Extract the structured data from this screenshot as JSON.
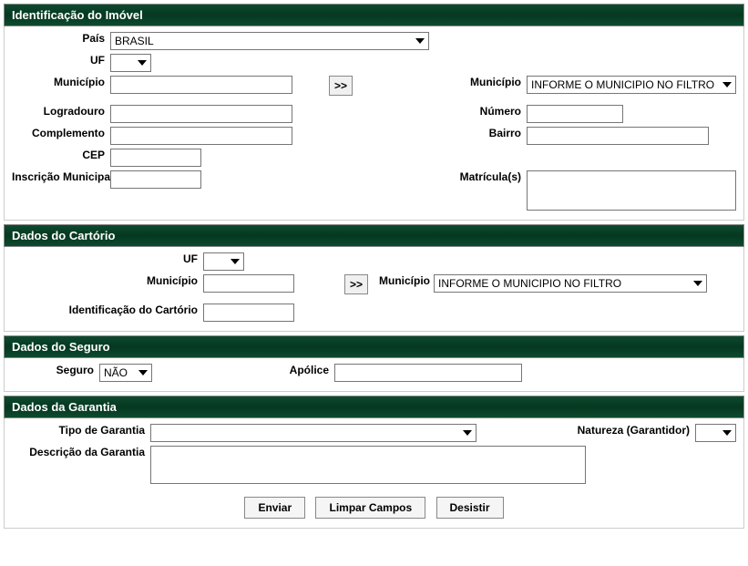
{
  "sections": {
    "imovel": {
      "title": "Identificação do Imóvel"
    },
    "cartorio": {
      "title": "Dados do Cartório"
    },
    "seguro": {
      "title": "Dados do Seguro"
    },
    "garantia": {
      "title": "Dados da Garantia"
    }
  },
  "imovel": {
    "pais_label": "País",
    "pais_value": "BRASIL",
    "uf_label": "UF",
    "uf_value": "",
    "municipio_label": "Município",
    "municipio_input": "",
    "lookup_btn": ">>",
    "municipio_select_label": "Município",
    "municipio_select_value": "INFORME O MUNICIPIO NO FILTRO",
    "logradouro_label": "Logradouro",
    "logradouro_value": "",
    "numero_label": "Número",
    "numero_value": "",
    "complemento_label": "Complemento",
    "complemento_value": "",
    "bairro_label": "Bairro",
    "bairro_value": "",
    "cep_label": "CEP",
    "cep_value": "",
    "inscricao_label": "Inscrição Municipal",
    "inscricao_value": "",
    "matriculas_label": "Matrícula(s)",
    "matriculas_value": ""
  },
  "cartorio": {
    "uf_label": "UF",
    "uf_value": "",
    "municipio_label": "Município",
    "municipio_input": "",
    "lookup_btn": ">>",
    "municipio_select_label": "Município",
    "municipio_select_value": "INFORME O MUNICIPIO NO FILTRO",
    "ident_label": "Identificação do Cartório",
    "ident_value": ""
  },
  "seguro": {
    "seguro_label": "Seguro",
    "seguro_value": "NÃO",
    "apolice_label": "Apólice",
    "apolice_value": ""
  },
  "garantia": {
    "tipo_label": "Tipo de Garantia",
    "tipo_value": "",
    "natureza_label": "Natureza (Garantidor)",
    "natureza_value": "",
    "descricao_label": "Descrição da Garantia",
    "descricao_value": ""
  },
  "buttons": {
    "enviar": "Enviar",
    "limpar": "Limpar Campos",
    "desistir": "Desistir"
  }
}
